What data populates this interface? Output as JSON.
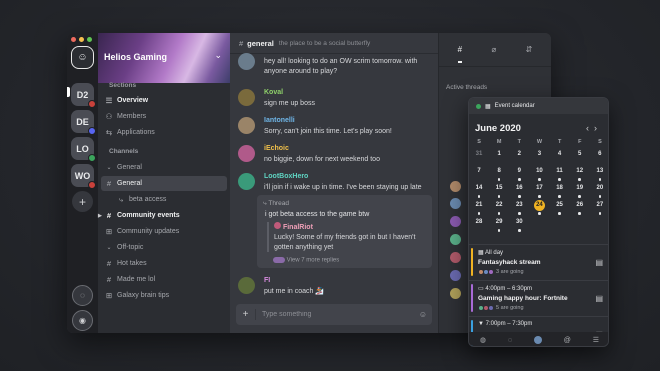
{
  "server": {
    "name": "Helios Gaming",
    "rail_items": [
      {
        "label": "D2",
        "color": "#4c4f57",
        "status": "#c9413b"
      },
      {
        "label": "DE",
        "color": "#4c4f57",
        "status": "#5865f2"
      },
      {
        "label": "LO",
        "color": "#4c4f57",
        "status": "#3ba55c"
      },
      {
        "label": "WO",
        "color": "#4c4f57",
        "status": "#c9413b"
      }
    ],
    "add_label": "+"
  },
  "sidebar": {
    "sections_label": "Sections",
    "sections": [
      {
        "label": "Overview",
        "icon": "list-icon",
        "bold": true
      },
      {
        "label": "Members",
        "icon": "members-icon",
        "bold": false
      },
      {
        "label": "Applications",
        "icon": "apps-icon",
        "bold": false
      }
    ],
    "channels_label": "Channels",
    "general_label": "General",
    "channels": [
      {
        "label": "General",
        "active": true
      },
      {
        "label": "beta access",
        "sub": true
      },
      {
        "label": "Community events",
        "bold": true
      },
      {
        "label": "Community updates"
      }
    ],
    "offtopic_label": "Off-topic",
    "offtopic": [
      {
        "label": "Hot takes"
      },
      {
        "label": "Made me lol"
      },
      {
        "label": "Galaxy brain tips"
      }
    ]
  },
  "chat": {
    "channel": "general",
    "topic": "the place to be a social butterfly",
    "messages": [
      {
        "author": "",
        "color": "#e6e7e9",
        "text": "hey all! looking to do an OW scrim tomorrow. with anyone around to play?",
        "avatar": "#6a7c8c"
      },
      {
        "author": "Koval",
        "color": "#8fd16a",
        "text": "sign me up boss",
        "avatar": "#7a6a3c"
      },
      {
        "author": "Iantonelli",
        "color": "#6fb6e8",
        "text": "Sorry, can't join this time. Let's play soon!",
        "avatar": "#9a8468"
      },
      {
        "author": "iEchoic",
        "color": "#f0c04a",
        "text": "no biggie, down for next weekend too",
        "avatar": "#b05a8a"
      },
      {
        "author": "LootBoxHero",
        "color": "#5fd5c3",
        "text": "i'll join if i wake up in time. I've been staying up late",
        "avatar": "#3a9a7a"
      },
      {
        "author": "FI",
        "color": "#d88be0",
        "text": "put me in coach 🏂",
        "avatar": "#5a6a3a"
      }
    ],
    "thread": {
      "label": "Thread",
      "question": "i got beta access to the game btw",
      "reply_author": "FinalRiot",
      "reply_text": "Lucky! Some of my friends got in but I haven't gotten anything yet",
      "more": "View 7 more replies"
    },
    "composer_placeholder": "Type something"
  },
  "right_panel": {
    "active_threads_label": "Active threads",
    "calendar": {
      "header": "Event calendar",
      "month": "June 2020",
      "weekdays": [
        "S",
        "M",
        "T",
        "W",
        "T",
        "F",
        "S"
      ],
      "weeks": [
        [
          "31",
          "1",
          "2",
          "3",
          "4",
          "5",
          "6"
        ],
        [
          "7",
          "8",
          "9",
          "10",
          "11",
          "12",
          "13"
        ],
        [
          "14",
          "15",
          "16",
          "17",
          "18",
          "19",
          "20"
        ],
        [
          "21",
          "22",
          "23",
          "24",
          "25",
          "26",
          "27"
        ],
        [
          "28",
          "29",
          "30",
          "",
          "",
          "",
          ""
        ]
      ],
      "today": "24",
      "events": [
        {
          "time": "All day",
          "name": "Fantasyhack stream",
          "going": "3 are going",
          "bar": "#f0b323"
        },
        {
          "time": "4:00pm – 6:30pm",
          "name": "Gaming happy hour: Fortnite",
          "going": "5 are going",
          "bar": "#a86ad6"
        },
        {
          "time": "7:00pm – 7:30pm",
          "name": "",
          "going": "",
          "bar": "#3aa0e0"
        }
      ]
    }
  }
}
